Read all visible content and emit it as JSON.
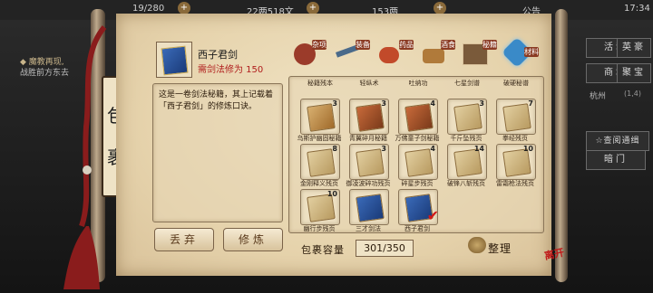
{
  "topbar": {
    "stamina": "19/280",
    "coins": "22两518文",
    "ingots": "153两",
    "notice": "公告",
    "time": "17:34"
  },
  "world": {
    "event_title": "◆ 魔教再现,",
    "event_body": "战胜前方东去"
  },
  "right_menu": {
    "activity": "活动",
    "ranking": "英豪",
    "shop": "商城",
    "treasure": "聚宝",
    "location": "杭州",
    "coords": "(1,4)",
    "quest": "☆查阅通缉",
    "dark_room": "暗门"
  },
  "bag": {
    "title_char_1": "包",
    "title_char_2": "裹",
    "capacity_label": "包裹容量",
    "capacity_value": "301/350",
    "discard_button": "丢弃",
    "practice_button": "修炼",
    "sort_button": "整理",
    "logo": "离开"
  },
  "selected_item": {
    "name": "西子君剑",
    "requirement": "需剑法修为 150",
    "description": "这是一卷剑法秘籍，其上记载着「西子君剑」的修炼口诀。"
  },
  "categories": [
    {
      "label": "杂项",
      "icon": "pouch-icon",
      "color": "#9b3b2a"
    },
    {
      "label": "装备",
      "icon": "sword-icon",
      "color": "#4a6a8a"
    },
    {
      "label": "药品",
      "icon": "fruit-icon",
      "color": "#c24a2a"
    },
    {
      "label": "酒食",
      "icon": "food-icon",
      "color": "#b07a3a"
    },
    {
      "label": "秘籍",
      "icon": "scroll-book-icon",
      "color": "#7a5a3a"
    },
    {
      "label": "材料",
      "icon": "crystal-icon",
      "color": "#3a8ac8"
    }
  ],
  "top_row_labels": [
    "秘籍残本",
    "轻纵术",
    "吐纳功",
    "七星剑谱",
    "破硬秘谱"
  ],
  "items": [
    {
      "name": "乌斯护幽固秘籍",
      "count": "3",
      "style": "map"
    },
    {
      "name": "青翼碎月秘籍",
      "count": "3",
      "style": "book-red"
    },
    {
      "name": "万佛童子剑秘籍",
      "count": "4",
      "style": "book-red"
    },
    {
      "name": "千斤坠残页",
      "count": "3",
      "style": "scroll"
    },
    {
      "name": "拳经残页",
      "count": "7",
      "style": "scroll"
    },
    {
      "name": "金刚释义残页",
      "count": "8",
      "style": "scroll"
    },
    {
      "name": "御凌波碎功残页",
      "count": "3",
      "style": "scroll"
    },
    {
      "name": "碎星步残页",
      "count": "4",
      "style": "scroll"
    },
    {
      "name": "破锋八斩残页",
      "count": "14",
      "style": "scroll"
    },
    {
      "name": "雷霜枪法残页",
      "count": "10",
      "style": "scroll"
    },
    {
      "name": "幽行步残页",
      "count": "10",
      "style": "scroll"
    },
    {
      "name": "三才剑法",
      "count": "",
      "style": "book-blue"
    },
    {
      "name": "西子君剑",
      "count": "",
      "style": "book-selected"
    }
  ]
}
